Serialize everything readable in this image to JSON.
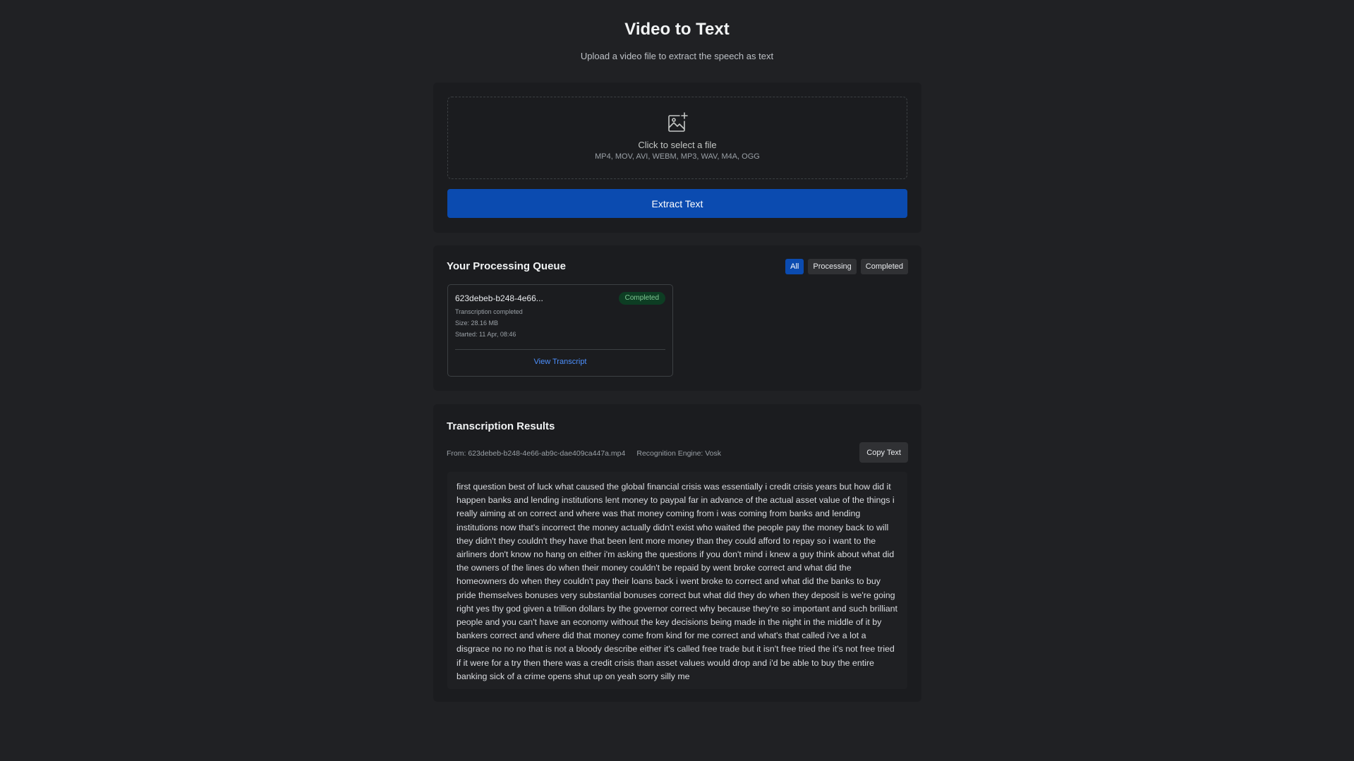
{
  "header": {
    "title": "Video to Text",
    "subtitle": "Upload a video file to extract the speech as text"
  },
  "upload": {
    "icon": "add-image-icon",
    "prompt": "Click to select a file",
    "formats": "MP4, MOV, AVI, WEBM, MP3, WAV, M4A, OGG",
    "extract_label": "Extract Text"
  },
  "queue": {
    "title": "Your Processing Queue",
    "filters": [
      {
        "label": "All",
        "active": true
      },
      {
        "label": "Processing",
        "active": false
      },
      {
        "label": "Completed",
        "active": false
      }
    ],
    "jobs": [
      {
        "name": "623debeb-b248-4e66...",
        "status": "Completed",
        "message": "Transcription completed",
        "size": "Size: 28.16 MB",
        "started": "Started: 11 Apr, 08:46",
        "action": "View Transcript"
      }
    ]
  },
  "results": {
    "title": "Transcription Results",
    "source": "From: 623debeb-b248-4e66-ab9c-dae409ca447a.mp4",
    "engine": "Recognition Engine: Vosk",
    "copy_label": "Copy Text",
    "text": "first question best of luck what caused the global financial crisis was essentially i credit crisis years but how did it happen banks and lending institutions lent money to paypal far in advance of the actual asset value of the things i really aiming at on correct and where was that money coming from i was coming from banks and lending institutions now that's incorrect the money actually didn't exist who waited the people pay the money back to will they didn't they couldn't they have that been lent more money than they could afford to repay so i want to the airliners don't know no hang on either i'm asking the questions if you don't mind i knew a guy think about what did the owners of the lines do when their money couldn't be repaid by went broke correct and what did the homeowners do when they couldn't pay their loans back i went broke to correct and what did the banks to buy pride themselves bonuses very substantial bonuses correct but what did they do when they deposit is we're going right yes thy god given a trillion dollars by the governor correct why because they're so important and such brilliant people and you can't have an economy without the key decisions being made in the night in the middle of it by bankers correct and where did that money come from kind for me correct and what's that called i've a lot a disgrace no no no that is not a bloody describe either it's called free trade but it isn't free tried the it's not free tried if it were for a try then there was a credit crisis than asset values would drop and i'd be able to buy the entire banking sick of a crime opens shut up on yeah sorry silly me"
  },
  "colors": {
    "background": "#202124",
    "card": "#1b1c1f",
    "accent": "#0b4bb0",
    "success_bg": "#0d3d23",
    "success_text": "#81c995",
    "link": "#4d90fe"
  }
}
